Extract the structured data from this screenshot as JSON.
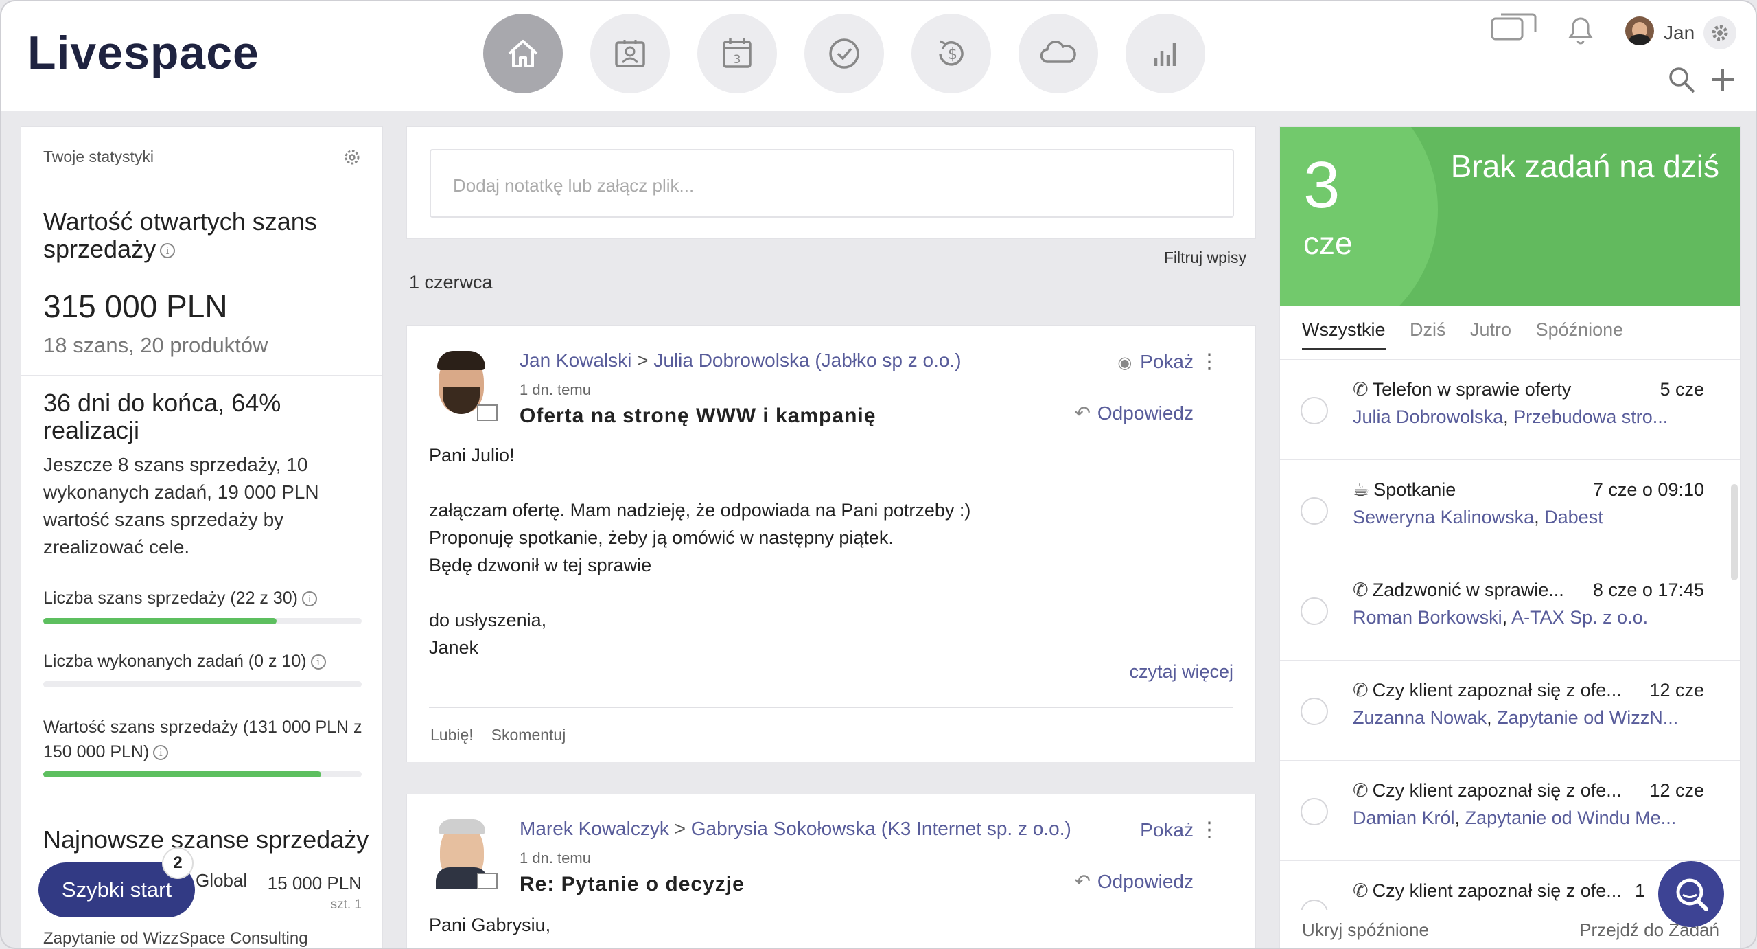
{
  "app": {
    "logo": "Livespace"
  },
  "header": {
    "nav": [
      {
        "name": "home-icon"
      },
      {
        "name": "contacts-icon"
      },
      {
        "name": "calendar-icon"
      },
      {
        "name": "tasks-icon"
      },
      {
        "name": "deals-icon"
      },
      {
        "name": "cloud-icon"
      },
      {
        "name": "reports-icon"
      }
    ],
    "calendar_day": "3",
    "user_name": "Jan"
  },
  "stats": {
    "panel_title": "Twoje statystyki",
    "open_value_title": "Wartość otwartych szans sprzedaży",
    "open_value": "315 000 PLN",
    "open_value_sub": "18 szans,  20 produktów",
    "days_title": "36 dni do końca, 64% realizacji",
    "days_text": "Jeszcze 8 szans sprzedaży, 10 wykonanych zadań, 19 000 PLN wartość szans sprzedaży by zrealizować cele.",
    "goals": [
      {
        "label": "Liczba szans sprzedaży (22 z 30)",
        "progress": 0.733
      },
      {
        "label": "Liczba wykonanych zadań (0 z 10)",
        "progress": 0
      },
      {
        "label": "Wartość szans sprzedaży (131 000 PLN z 150 000 PLN)",
        "progress": 0.873
      }
    ],
    "newest_title": "Najnowsze szanse sprzedaży",
    "newest_item": {
      "name": "Global",
      "value": "15 000 PLN",
      "qty": "szt. 1"
    },
    "next_item_partial": "Zapytanie od WizzSpace Consulting"
  },
  "feed": {
    "note_placeholder": "Dodaj notatkę lub załącz plik...",
    "filter": "Filtruj wpisy",
    "date": "1 czerwca",
    "entries": [
      {
        "author": "Jan Kowalski",
        "sep": " > ",
        "target": "Julia Dobrowolska (Jabłko sp z o.o.)",
        "ago": "1 dn. temu",
        "subject": "Oferta na stronę WWW i kampanię",
        "show": "Pokaż",
        "reply": "Odpowiedz",
        "body": [
          "Pani Julio!",
          "",
          "załączam ofertę. Mam nadzieję, że odpowiada na Pani potrzeby :)",
          "Proponuję spotkanie, żeby ją omówić w następny piątek.",
          "Będę dzwonił w tej sprawie",
          "",
          "do usłyszenia,",
          "Janek"
        ],
        "read_more": "czytaj więcej",
        "like": "Lubię!",
        "comment": "Skomentuj"
      },
      {
        "author": "Marek Kowalczyk",
        "sep": " > ",
        "target": "Gabrysia Sokołowska (K3 Internet sp. z o.o.)",
        "ago": "1 dn. temu",
        "subject": "Re: Pytanie o decyzje",
        "show": "Pokaż",
        "reply": "Odpowiedz",
        "body": [
          "Pani Gabrysiu,"
        ]
      }
    ]
  },
  "tasks": {
    "day": "3",
    "month": "cze",
    "banner": "Brak zadań na dziś",
    "tabs": [
      "Wszystkie",
      "Dziś",
      "Jutro",
      "Spóźnione"
    ],
    "items": [
      {
        "type": "phone-icon",
        "title": "Telefon w sprawie oferty",
        "date": "5 cze",
        "person": "Julia Dobrowolska",
        "sep": ", ",
        "related": "Przebudowa stro..."
      },
      {
        "type": "meeting-icon",
        "title": "Spotkanie",
        "date": "7 cze o 09:10",
        "person": "Seweryna Kalinowska",
        "sep": ", ",
        "related": "Dabest"
      },
      {
        "type": "phone-icon",
        "title": "Zadzwonić w sprawie...",
        "date": "8 cze o 17:45",
        "person": "Roman Borkowski",
        "sep": ", ",
        "related": "A-TAX Sp. z o.o."
      },
      {
        "type": "phone-icon",
        "title": "Czy klient zapoznał się z ofe...",
        "date": "12 cze",
        "person": "Zuzanna Nowak",
        "sep": ", ",
        "related": "Zapytanie od WizzN..."
      },
      {
        "type": "phone-icon",
        "title": "Czy klient zapoznał się z ofe...",
        "date": "12 cze",
        "person": "Damian Król",
        "sep": ", ",
        "related": "Zapytanie od Windu Me..."
      },
      {
        "type": "phone-icon",
        "title": "Czy klient zapoznał się z ofe...",
        "date": "1",
        "person": "",
        "sep": "",
        "related": ""
      }
    ],
    "hide_overdue": "Ukryj spóźnione",
    "go_to_tasks": "Przejdź do Zadań"
  },
  "quick_start": {
    "label": "Szybki start",
    "badge": "2"
  },
  "colors": {
    "accent": "#585c9a",
    "brand_dark": "#323a84",
    "green": "#62ba5e",
    "progress": "#5dbf5f"
  }
}
